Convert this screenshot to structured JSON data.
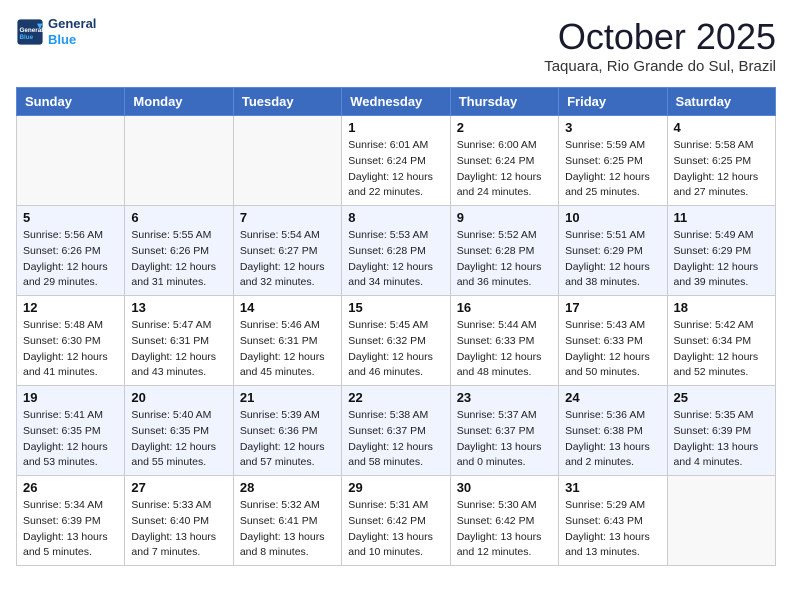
{
  "header": {
    "logo_general": "General",
    "logo_blue": "Blue",
    "month_title": "October 2025",
    "location": "Taquara, Rio Grande do Sul, Brazil"
  },
  "weekdays": [
    "Sunday",
    "Monday",
    "Tuesday",
    "Wednesday",
    "Thursday",
    "Friday",
    "Saturday"
  ],
  "weeks": [
    [
      {
        "day": "",
        "info": ""
      },
      {
        "day": "",
        "info": ""
      },
      {
        "day": "",
        "info": ""
      },
      {
        "day": "1",
        "info": "Sunrise: 6:01 AM\nSunset: 6:24 PM\nDaylight: 12 hours\nand 22 minutes."
      },
      {
        "day": "2",
        "info": "Sunrise: 6:00 AM\nSunset: 6:24 PM\nDaylight: 12 hours\nand 24 minutes."
      },
      {
        "day": "3",
        "info": "Sunrise: 5:59 AM\nSunset: 6:25 PM\nDaylight: 12 hours\nand 25 minutes."
      },
      {
        "day": "4",
        "info": "Sunrise: 5:58 AM\nSunset: 6:25 PM\nDaylight: 12 hours\nand 27 minutes."
      }
    ],
    [
      {
        "day": "5",
        "info": "Sunrise: 5:56 AM\nSunset: 6:26 PM\nDaylight: 12 hours\nand 29 minutes."
      },
      {
        "day": "6",
        "info": "Sunrise: 5:55 AM\nSunset: 6:26 PM\nDaylight: 12 hours\nand 31 minutes."
      },
      {
        "day": "7",
        "info": "Sunrise: 5:54 AM\nSunset: 6:27 PM\nDaylight: 12 hours\nand 32 minutes."
      },
      {
        "day": "8",
        "info": "Sunrise: 5:53 AM\nSunset: 6:28 PM\nDaylight: 12 hours\nand 34 minutes."
      },
      {
        "day": "9",
        "info": "Sunrise: 5:52 AM\nSunset: 6:28 PM\nDaylight: 12 hours\nand 36 minutes."
      },
      {
        "day": "10",
        "info": "Sunrise: 5:51 AM\nSunset: 6:29 PM\nDaylight: 12 hours\nand 38 minutes."
      },
      {
        "day": "11",
        "info": "Sunrise: 5:49 AM\nSunset: 6:29 PM\nDaylight: 12 hours\nand 39 minutes."
      }
    ],
    [
      {
        "day": "12",
        "info": "Sunrise: 5:48 AM\nSunset: 6:30 PM\nDaylight: 12 hours\nand 41 minutes."
      },
      {
        "day": "13",
        "info": "Sunrise: 5:47 AM\nSunset: 6:31 PM\nDaylight: 12 hours\nand 43 minutes."
      },
      {
        "day": "14",
        "info": "Sunrise: 5:46 AM\nSunset: 6:31 PM\nDaylight: 12 hours\nand 45 minutes."
      },
      {
        "day": "15",
        "info": "Sunrise: 5:45 AM\nSunset: 6:32 PM\nDaylight: 12 hours\nand 46 minutes."
      },
      {
        "day": "16",
        "info": "Sunrise: 5:44 AM\nSunset: 6:33 PM\nDaylight: 12 hours\nand 48 minutes."
      },
      {
        "day": "17",
        "info": "Sunrise: 5:43 AM\nSunset: 6:33 PM\nDaylight: 12 hours\nand 50 minutes."
      },
      {
        "day": "18",
        "info": "Sunrise: 5:42 AM\nSunset: 6:34 PM\nDaylight: 12 hours\nand 52 minutes."
      }
    ],
    [
      {
        "day": "19",
        "info": "Sunrise: 5:41 AM\nSunset: 6:35 PM\nDaylight: 12 hours\nand 53 minutes."
      },
      {
        "day": "20",
        "info": "Sunrise: 5:40 AM\nSunset: 6:35 PM\nDaylight: 12 hours\nand 55 minutes."
      },
      {
        "day": "21",
        "info": "Sunrise: 5:39 AM\nSunset: 6:36 PM\nDaylight: 12 hours\nand 57 minutes."
      },
      {
        "day": "22",
        "info": "Sunrise: 5:38 AM\nSunset: 6:37 PM\nDaylight: 12 hours\nand 58 minutes."
      },
      {
        "day": "23",
        "info": "Sunrise: 5:37 AM\nSunset: 6:37 PM\nDaylight: 13 hours\nand 0 minutes."
      },
      {
        "day": "24",
        "info": "Sunrise: 5:36 AM\nSunset: 6:38 PM\nDaylight: 13 hours\nand 2 minutes."
      },
      {
        "day": "25",
        "info": "Sunrise: 5:35 AM\nSunset: 6:39 PM\nDaylight: 13 hours\nand 4 minutes."
      }
    ],
    [
      {
        "day": "26",
        "info": "Sunrise: 5:34 AM\nSunset: 6:39 PM\nDaylight: 13 hours\nand 5 minutes."
      },
      {
        "day": "27",
        "info": "Sunrise: 5:33 AM\nSunset: 6:40 PM\nDaylight: 13 hours\nand 7 minutes."
      },
      {
        "day": "28",
        "info": "Sunrise: 5:32 AM\nSunset: 6:41 PM\nDaylight: 13 hours\nand 8 minutes."
      },
      {
        "day": "29",
        "info": "Sunrise: 5:31 AM\nSunset: 6:42 PM\nDaylight: 13 hours\nand 10 minutes."
      },
      {
        "day": "30",
        "info": "Sunrise: 5:30 AM\nSunset: 6:42 PM\nDaylight: 13 hours\nand 12 minutes."
      },
      {
        "day": "31",
        "info": "Sunrise: 5:29 AM\nSunset: 6:43 PM\nDaylight: 13 hours\nand 13 minutes."
      },
      {
        "day": "",
        "info": ""
      }
    ]
  ]
}
